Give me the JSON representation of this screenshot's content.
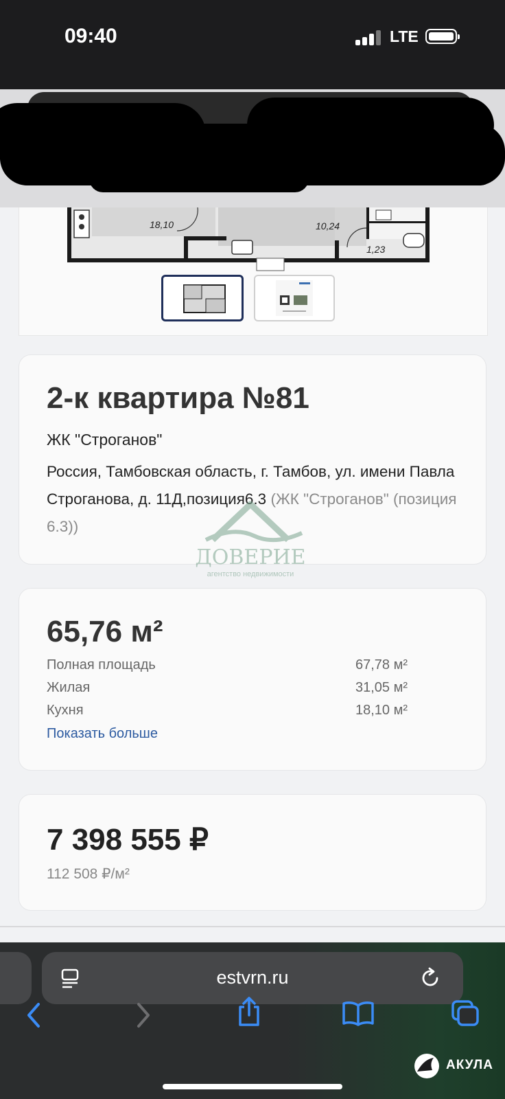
{
  "status_bar": {
    "time": "09:40",
    "network": "LTE"
  },
  "floor_plan": {
    "room_areas": [
      "18,10",
      "10,24",
      "1,23"
    ],
    "thumbnails": [
      "plan-thumbnail",
      "qr-document-thumbnail"
    ],
    "selected_thumbnail": 0
  },
  "apartment": {
    "title": "2-к квартира №81",
    "complex": "ЖК \"Строганов\"",
    "address_main": "Россия, Тамбовская область, г. Тамбов, ул. имени Павла Строганова, д. 11Д,позиция6.3",
    "address_muted": "(ЖК \"Строганов\" (позиция 6.3))"
  },
  "area": {
    "headline": "65,76 м²",
    "rows": [
      {
        "label": "Полная площадь",
        "value": "67,78 м²"
      },
      {
        "label": "Жилая",
        "value": "31,05 м²"
      },
      {
        "label": "Кухня",
        "value": "18,10 м²"
      }
    ],
    "show_more": "Показать больше"
  },
  "price": {
    "total": "7 398 555 ₽",
    "per_m2": "112 508 ₽/м²"
  },
  "watermark": {
    "name": "ДОВЕРИЕ",
    "tagline": "агентство недвижимости"
  },
  "browser": {
    "url": "estvrn.ru"
  },
  "overlay_logo": {
    "text": "АКУЛА"
  },
  "colors": {
    "link": "#2c5aa0",
    "status_bg": "#1c1c1e",
    "toolbar_bg": "#2b2d2e",
    "icon_blue": "#3b8cf6"
  }
}
